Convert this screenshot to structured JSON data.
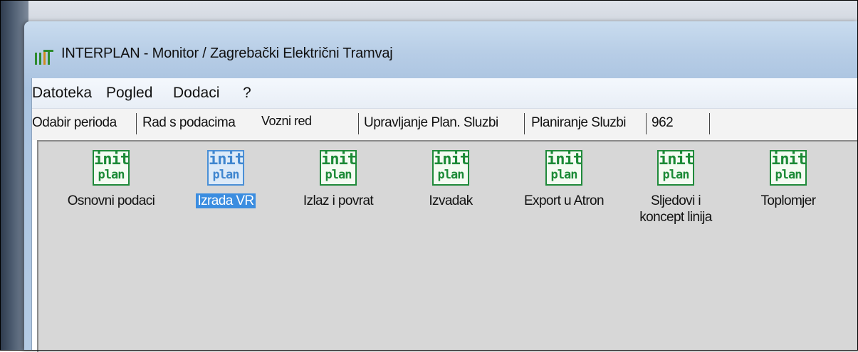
{
  "window": {
    "title": "INTERPLAN - Monitor / Zagrebački Električni Tramvaj"
  },
  "menu": [
    {
      "label": "Datoteka"
    },
    {
      "label": "Pogled"
    },
    {
      "label": "Dodaci"
    },
    {
      "label": "?"
    }
  ],
  "tabs": [
    {
      "label": "Odabir perioda"
    },
    {
      "label": "Rad s podacima"
    },
    {
      "label": "Vozni red",
      "active": true
    },
    {
      "label": "Upravljanje Plan. Sluzbi"
    },
    {
      "label": "Planiranje Sluzbi"
    },
    {
      "label": "962"
    }
  ],
  "tools": [
    {
      "icon_top": "init",
      "icon_bottom": "plan",
      "label": "Osnovni podaci",
      "icon": "initplan-icon"
    },
    {
      "icon_top": "init",
      "icon_bottom": "plan",
      "label": "Izrada VR",
      "icon": "initplan-icon",
      "selected": true
    },
    {
      "icon_top": "init",
      "icon_bottom": "plan",
      "label": "Izlaz i povrat",
      "icon": "initplan-icon"
    },
    {
      "icon_top": "init",
      "icon_bottom": "plan",
      "label": "Izvadak",
      "icon": "initplan-icon"
    },
    {
      "icon_top": "init",
      "icon_bottom": "plan",
      "label": "Export u Atron",
      "icon": "initplan-icon"
    },
    {
      "icon_top": "init",
      "icon_bottom": "plan",
      "label": "Sljedovi i koncept linija",
      "icon": "initplan-icon"
    },
    {
      "icon_top": "init",
      "icon_bottom": "plan",
      "label": "Toplomjer",
      "icon": "initplan-icon"
    }
  ],
  "colors": {
    "icon_green": "#1b8a36",
    "selection_blue": "#3b8de0",
    "panel_gray": "#d7d7d7"
  }
}
